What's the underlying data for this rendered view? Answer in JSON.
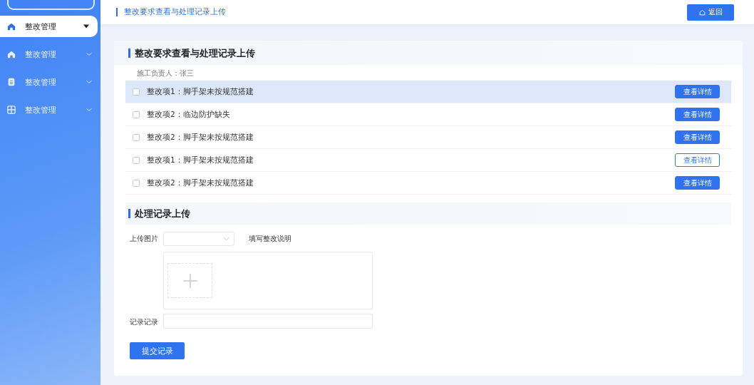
{
  "sidebar": {
    "items": [
      {
        "label": "整改管理",
        "kind": "home",
        "selected": true,
        "expanded": true
      },
      {
        "label": "整改管理",
        "kind": "home",
        "selected": false,
        "expanded": false
      },
      {
        "label": "整改管理",
        "kind": "document",
        "selected": false,
        "expanded": false
      },
      {
        "label": "整改管理",
        "kind": "grid",
        "selected": false,
        "expanded": false
      }
    ]
  },
  "header": {
    "title": "整改要求查看与处理记录上传",
    "back_button": "返回"
  },
  "requirements": {
    "title": "整改要求查看与处理记录上传",
    "owner": "施工负责人：张三",
    "rows": [
      {
        "text": "整改项1：脚手架未按规范搭建",
        "checked": false,
        "selected": true,
        "button": "查看详情",
        "kind": "filled"
      },
      {
        "text": "整改项2：临边防护缺失",
        "checked": false,
        "selected": false,
        "button": "查看详情",
        "kind": "filled"
      },
      {
        "text": "整改项2：脚手架未按规范搭建",
        "checked": false,
        "selected": false,
        "button": "查看详情",
        "kind": "filled"
      },
      {
        "text": "整改项1：脚手架未按规范搭建",
        "checked": false,
        "selected": false,
        "button": "查看详情",
        "kind": "outline"
      },
      {
        "text": "整改项2：脚手架未按规范搭建",
        "checked": false,
        "selected": false,
        "button": "查看详情",
        "kind": "filled"
      }
    ]
  },
  "upload": {
    "title": "处理记录上传",
    "image_label": "上传图片",
    "note_label": "填写整改说明",
    "record_label": "记录记录",
    "submit": "提交记录"
  }
}
